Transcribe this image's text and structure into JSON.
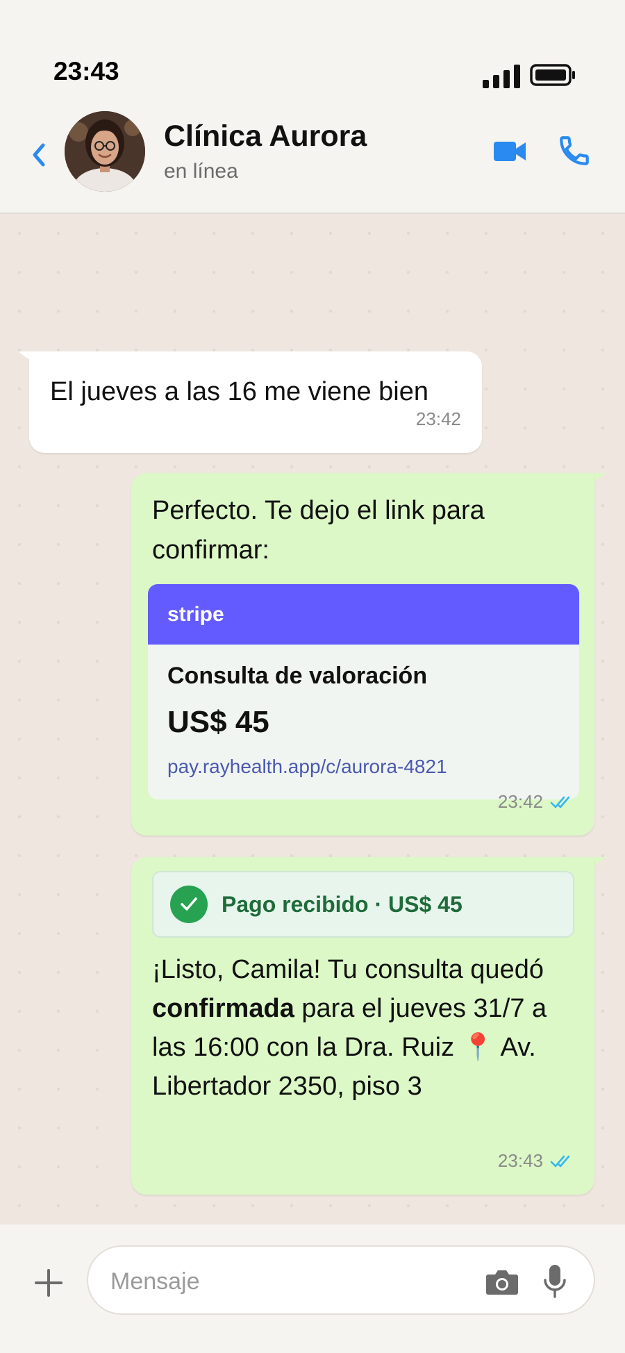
{
  "status_bar": {
    "time": "23:43"
  },
  "header": {
    "contact_name": "Clínica Aurora",
    "contact_status": "en línea"
  },
  "messages": [
    {
      "direction": "incoming",
      "text": "El jueves a las 16 me viene bien",
      "time": "23:42"
    },
    {
      "direction": "outgoing",
      "text": "Perfecto. Te dejo el link para confirmar:",
      "time": "23:42",
      "read": true,
      "payment_card": {
        "brand": "stripe",
        "title": "Consulta de valoración",
        "amount": "US$ 45",
        "url": "pay.rayhealth.app/c/aurora-4821",
        "brand_color": "#635bff"
      }
    },
    {
      "direction": "outgoing",
      "payment_status": "Pago recibido · US$ 45",
      "text_before": "¡Listo, Camila! Tu consulta quedó ",
      "text_bold": "confirmada",
      "text_after": " para el jueves 31/7 a las 16:00 con la Dra. Ruiz 📍 Av. Libertador 2350, piso 3",
      "time": "23:43",
      "read": true
    }
  ],
  "composer": {
    "placeholder": "Mensaje"
  },
  "colors": {
    "accent": "#2a8af0",
    "outgoing_bubble": "#dcf8c6",
    "incoming_bubble": "#ffffff",
    "read_ticks": "#34b7f1",
    "success": "#27a251"
  },
  "icons": {
    "back": "chevron-left-icon",
    "video": "video-camera-icon",
    "call": "phone-icon",
    "add": "plus-icon",
    "camera": "camera-icon",
    "mic": "microphone-icon",
    "check": "check-icon",
    "read": "double-check-icon",
    "location": "pin-icon"
  }
}
